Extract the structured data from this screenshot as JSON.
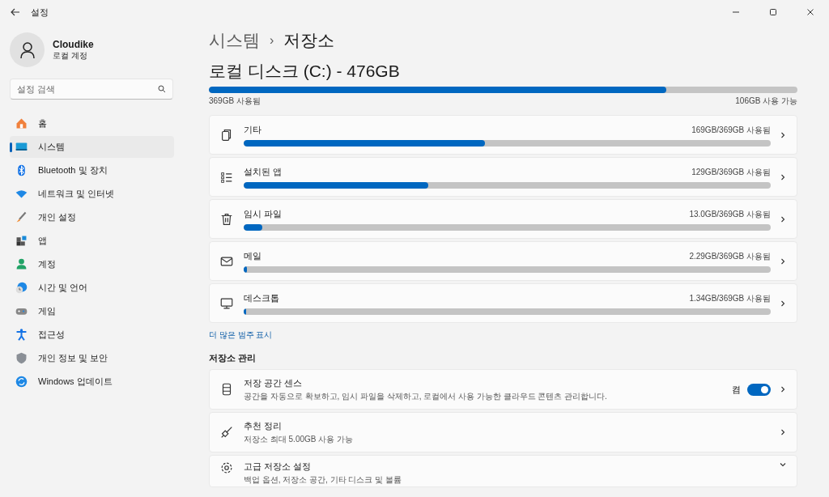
{
  "window": {
    "title": "설정"
  },
  "profile": {
    "name": "Cloudike",
    "account": "로컬 계정"
  },
  "search": {
    "placeholder": "설정 검색"
  },
  "sidebar": {
    "items": [
      {
        "label": "홈",
        "selected": false
      },
      {
        "label": "시스템",
        "selected": true
      },
      {
        "label": "Bluetooth 및 장치",
        "selected": false
      },
      {
        "label": "네트워크 및 인터넷",
        "selected": false
      },
      {
        "label": "개인 설정",
        "selected": false
      },
      {
        "label": "앱",
        "selected": false
      },
      {
        "label": "계정",
        "selected": false
      },
      {
        "label": "시간 및 언어",
        "selected": false
      },
      {
        "label": "게임",
        "selected": false
      },
      {
        "label": "접근성",
        "selected": false
      },
      {
        "label": "개인 정보 및 보안",
        "selected": false
      },
      {
        "label": "Windows 업데이트",
        "selected": false
      }
    ]
  },
  "breadcrumb": {
    "parent": "시스템",
    "separator": "›",
    "current": "저장소"
  },
  "disk": {
    "title": "로컬 디스크 (C:) - 476GB",
    "level": 0.777,
    "used": "369GB 사용됨",
    "free": "106GB 사용 가능"
  },
  "categories": [
    {
      "label": "기타",
      "usage": "169GB/369GB 사용됨",
      "level": 0.458
    },
    {
      "label": "설치된 앱",
      "usage": "129GB/369GB 사용됨",
      "level": 0.35
    },
    {
      "label": "임시 파일",
      "usage": "13.0GB/369GB 사용됨",
      "level": 0.035
    },
    {
      "label": "메일",
      "usage": "2.29GB/369GB 사용됨",
      "level": 0.006
    },
    {
      "label": "데스크톱",
      "usage": "1.34GB/369GB 사용됨",
      "level": 0.004
    }
  ],
  "more_link": "더 많은 범주 표시",
  "management": {
    "title": "저장소 관리",
    "items": [
      {
        "kind": "toggle",
        "title": "저장 공간 센스",
        "subtitle": "공간을 자동으로 확보하고, 임시 파일을 삭제하고, 로컬에서 사용 가능한 클라우드 콘텐츠 관리합니다.",
        "state_label": "켬",
        "on": true
      },
      {
        "kind": "link",
        "title": "추천 정리",
        "subtitle": "저장소 최대 5.00GB 사용 가능"
      },
      {
        "kind": "expand",
        "title": "고급 저장소 설정",
        "subtitle": "백업 옵션, 저장소 공간, 기타 디스크 및 볼륨"
      }
    ]
  }
}
